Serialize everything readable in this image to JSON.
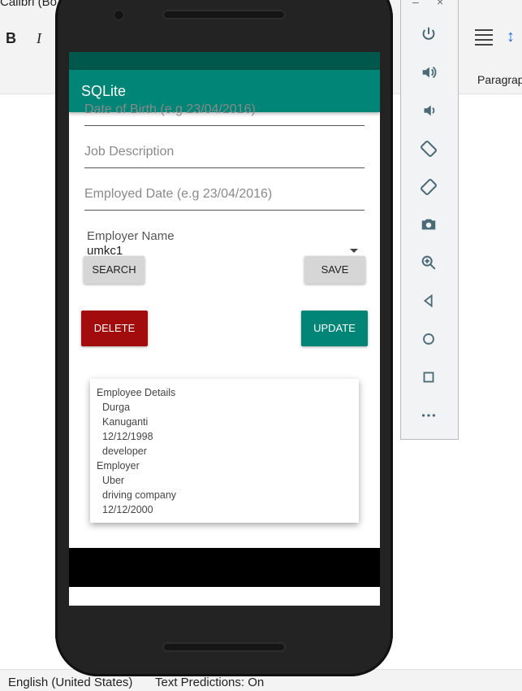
{
  "word": {
    "font_box": "Calibri (Bo",
    "bold": "B",
    "italic": "I",
    "paragraph_group": "Paragrap"
  },
  "status": {
    "language": "English (United States)",
    "predictions": "Text Predictions: On"
  },
  "app": {
    "title": "SQLite",
    "fields": {
      "dob_placeholder": "Date of Birth (e.g 23/04/2016)",
      "job_placeholder": "Job Description",
      "employed_placeholder": "Employed Date (e.g 23/04/2016)"
    },
    "employer_label": "Employer Name",
    "employer_value": "umkc1",
    "buttons": {
      "search": "SEARCH",
      "save": "SAVE",
      "delete": "DELETE",
      "update": "UPDATE"
    },
    "details": {
      "employee_header": "Employee Details",
      "employee": [
        "Durga",
        "Kanuganti",
        "12/12/1998",
        "developer"
      ],
      "employer_header": "Employer",
      "employer": [
        "Uber",
        "driving company",
        "12/12/2000"
      ]
    },
    "colors": {
      "primary": "#008577",
      "primary_dark": "#00574B",
      "delete": "#A30C0C",
      "update": "#008577"
    }
  },
  "emulator_panel": {
    "window_controls": [
      "minimize-icon",
      "close-icon"
    ],
    "icons": [
      "power-icon",
      "volume-up-icon",
      "volume-down-icon",
      "rotate-left-icon",
      "rotate-right-icon",
      "camera-icon",
      "zoom-icon",
      "back-icon",
      "home-icon",
      "overview-icon",
      "more-icon"
    ]
  }
}
